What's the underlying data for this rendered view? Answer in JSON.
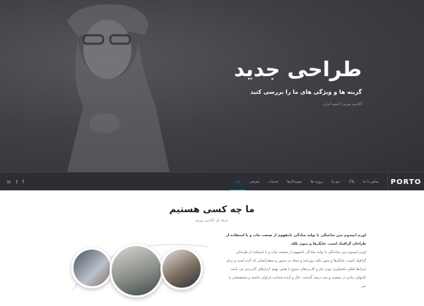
{
  "hero": {
    "title": "طراحی جدید",
    "subtitle": "گزینه ها و ویژگی های ما را بررسی کنید",
    "byline": "آکادمی پورتو / اسپید ایران"
  },
  "navbar": {
    "logo": "PORTO",
    "menu": [
      {
        "label": "خانه",
        "active": true
      },
      {
        "label": "معرفی",
        "active": false
      },
      {
        "label": "خدمات",
        "active": false
      },
      {
        "label": "نمونه‌کارها",
        "active": false
      },
      {
        "label": "پروژه ها",
        "active": false
      },
      {
        "label": "تیم ما",
        "active": false
      },
      {
        "label": "بلاگ",
        "active": false
      },
      {
        "label": "تماس با ما",
        "active": false
      }
    ],
    "socials": [
      {
        "icon": "linkedin-icon",
        "glyph": "in"
      },
      {
        "icon": "twitter-icon",
        "glyph": "t"
      },
      {
        "icon": "facebook-icon",
        "glyph": "f"
      }
    ]
  },
  "about": {
    "title": "ما چه کسی هستیم",
    "subtitle": "حرفه ای آکادمی پورتو",
    "lead": "لورم ایپسوم متن ساختگی با تولید سادگی نامفهوم از صنعت چاپ و با استفاده از طراحان گرافیک است. چاپگرها و متون بلکه",
    "body": "لورم ایپسوم متن ساختگی با تولید سادگی نامفهوم از صنعت چاپ و با استفاده از طراحان گرافیک است. چاپگرها و متون بلکه روزنامه و مجله در ستون و سطرآنچنان که لازم است و برای شرایط فعلی تکنولوژی مورد نیاز و کاربردهای متنوع با هدف بهبود ابزارهای کاربردی می باشد. کتابهای زیادی در شصت و سه درصد گذشته، حال و آینده شناخت فراوان جامعه و متخصصان را می"
  },
  "colors": {
    "accent": "#0088cc",
    "hero_bg": "#3f4146",
    "nav_bg": "#2c2e33"
  }
}
